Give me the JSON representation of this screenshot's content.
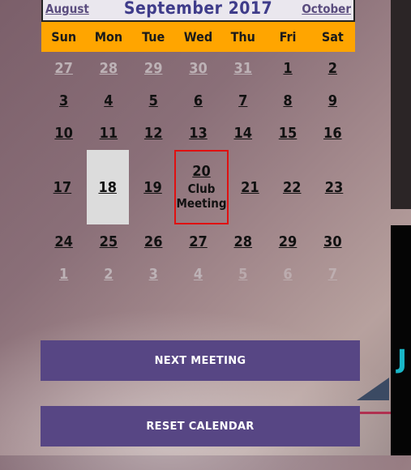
{
  "calendar": {
    "prev_month": "August",
    "title": "September 2017",
    "next_month": "October",
    "weekdays": [
      "Sun",
      "Mon",
      "Tue",
      "Wed",
      "Thu",
      "Fri",
      "Sat"
    ],
    "weeks": [
      [
        "27",
        "28",
        "29",
        "30",
        "31",
        "1",
        "2"
      ],
      [
        "3",
        "4",
        "5",
        "6",
        "7",
        "8",
        "9"
      ],
      [
        "10",
        "11",
        "12",
        "13",
        "14",
        "15",
        "16"
      ],
      [
        "17",
        "18",
        "19",
        "20",
        "21",
        "22",
        "23"
      ],
      [
        "24",
        "25",
        "26",
        "27",
        "28",
        "29",
        "30"
      ],
      [
        "1",
        "2",
        "3",
        "4",
        "5",
        "6",
        "7"
      ]
    ],
    "event": {
      "day": "20",
      "line1": "Club",
      "line2": "Meeting"
    }
  },
  "buttons": {
    "next_meeting": "NEXT MEETING",
    "reset_calendar": "RESET CALENDAR"
  },
  "side": {
    "glyph": "J"
  },
  "colors": {
    "header_bar": "#ffa500",
    "button": "#574684",
    "event_border": "#e01010",
    "today_bg": "#dcdcdc"
  }
}
